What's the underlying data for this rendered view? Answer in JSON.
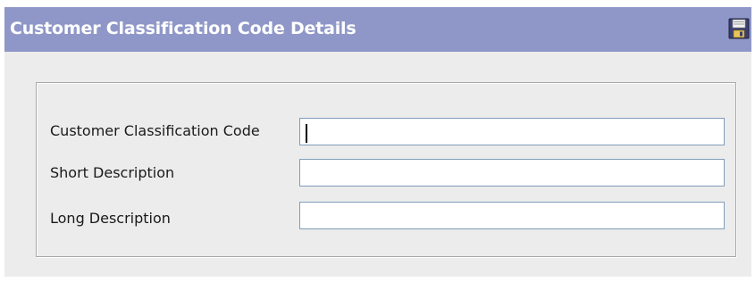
{
  "header": {
    "title": "Customer Classification Code Details",
    "save_icon": "floppy-disk-save-icon"
  },
  "form": {
    "fields": [
      {
        "label": "Customer Classification Code",
        "value": ""
      },
      {
        "label": "Short Description",
        "value": ""
      },
      {
        "label": "Long Description",
        "value": ""
      }
    ]
  },
  "colors": {
    "titlebar": "#8f97c8",
    "panel": "#ececec",
    "field_border": "#7f9db9"
  }
}
